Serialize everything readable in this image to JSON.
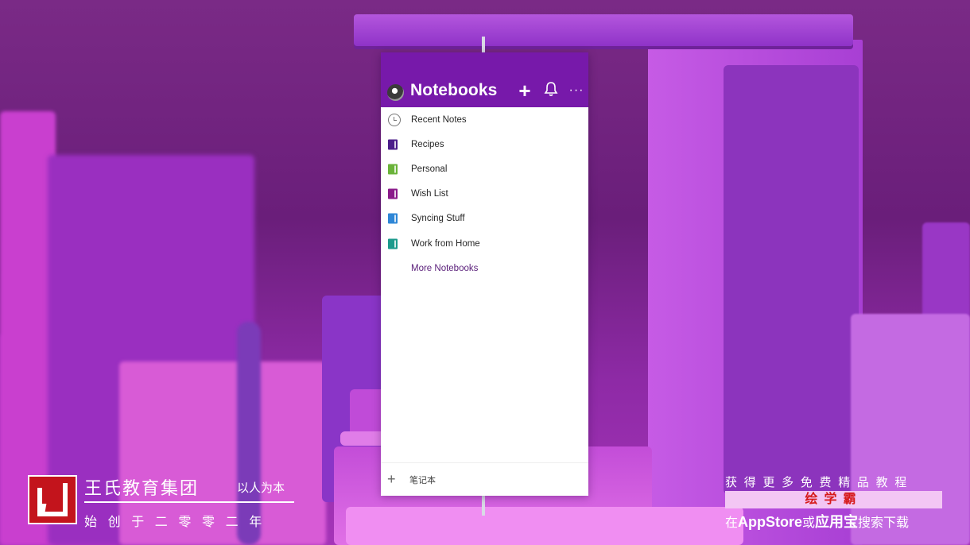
{
  "app": {
    "title": "Notebooks",
    "actions": {
      "add": "+",
      "notifications": "🔔",
      "more": "···"
    }
  },
  "notebooks": {
    "items": [
      {
        "label": "Recent Notes",
        "icon": "clock-icon",
        "color": ""
      },
      {
        "label": "Recipes",
        "icon": "notebook-icon",
        "color": "#4b1d8a"
      },
      {
        "label": "Personal",
        "icon": "notebook-icon",
        "color": "#6ab33a"
      },
      {
        "label": "Wish List",
        "icon": "notebook-icon",
        "color": "#8a1a8a"
      },
      {
        "label": "Syncing Stuff",
        "icon": "notebook-icon",
        "color": "#2e86d6"
      },
      {
        "label": "Work from Home",
        "icon": "notebook-icon",
        "color": "#1c9a8c"
      }
    ],
    "more_label": "More Notebooks"
  },
  "footer": {
    "add_icon": "+",
    "label": "笔记本"
  },
  "watermark": {
    "brand_name": "王氏教育集团",
    "motto": "以人为本",
    "founded": "始创于二零零二年",
    "promo_line": "获得更多免费精品教程",
    "promo_name": "绘学霸",
    "download_prefix": "在",
    "store_1": "AppStore",
    "download_or": "或",
    "store_2": "应用宝",
    "download_suffix": "搜索下载"
  },
  "colors": {
    "accent": "#7719aa",
    "background": "#7a2a86"
  }
}
